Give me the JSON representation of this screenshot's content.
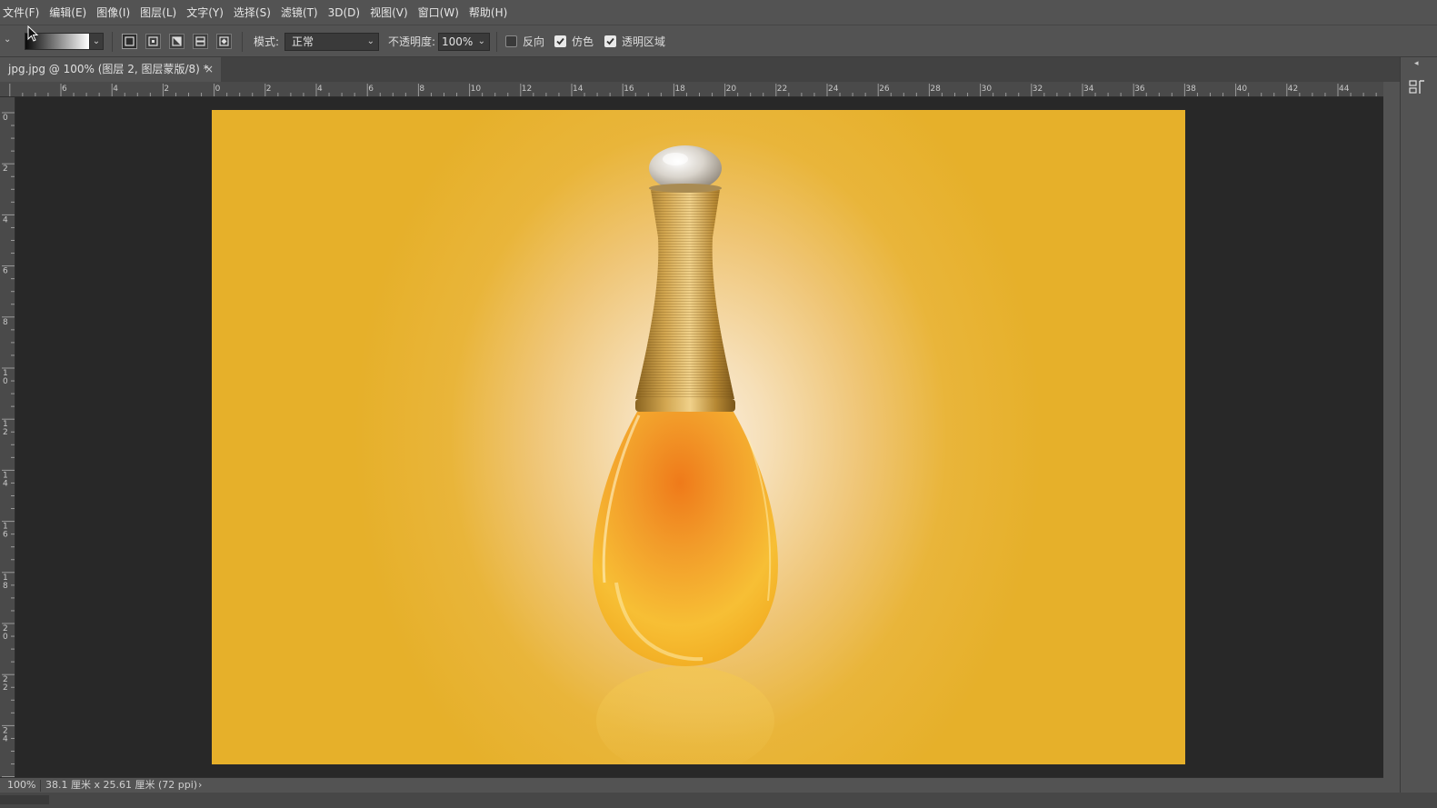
{
  "menubar": {
    "items": [
      "文件(F)",
      "编辑(E)",
      "图像(I)",
      "图层(L)",
      "文字(Y)",
      "选择(S)",
      "滤镜(T)",
      "3D(D)",
      "视图(V)",
      "窗口(W)",
      "帮助(H)"
    ]
  },
  "options": {
    "tool_menu_arrow": "⌄",
    "gradient_dropdown_arrow": "⌄",
    "gradient_types": [
      "linear",
      "radial",
      "angle",
      "reflected",
      "diamond"
    ],
    "active_gradient_type": "linear",
    "mode_label": "模式:",
    "mode_value": "正常",
    "opacity_label": "不透明度:",
    "opacity_value": "100%",
    "reverse_label": "反向",
    "reverse_checked": false,
    "dither_label": "仿色",
    "dither_checked": true,
    "transparency_label": "透明区域",
    "transparency_checked": true
  },
  "document_tab": {
    "title": "jpg.jpg @ 100% (图层 2, 图层蒙版/8) *",
    "close": "×"
  },
  "rulers": {
    "horizontal_labels": [
      "6",
      "4",
      "2",
      "0",
      "2",
      "4",
      "6",
      "8",
      "10",
      "12",
      "14",
      "16",
      "18",
      "20",
      "22",
      "24",
      "26",
      "28",
      "30",
      "32",
      "34",
      "36",
      "38",
      "40",
      "42",
      "44"
    ],
    "vertical_labels": [
      "0",
      "2",
      "4",
      "6",
      "8",
      "1\n0",
      "1\n2",
      "1\n4",
      "1\n6",
      "1\n8",
      "2\n0",
      "2\n2",
      "2\n4"
    ]
  },
  "status": {
    "zoom": "100%",
    "doc_size": "38.1 厘米 x 25.61 厘米 (72 ppi)",
    "arrow": "›"
  },
  "colors": {
    "canvas_background": "#e6b02a",
    "workspace": "#282828",
    "ui_panel": "#535353"
  }
}
